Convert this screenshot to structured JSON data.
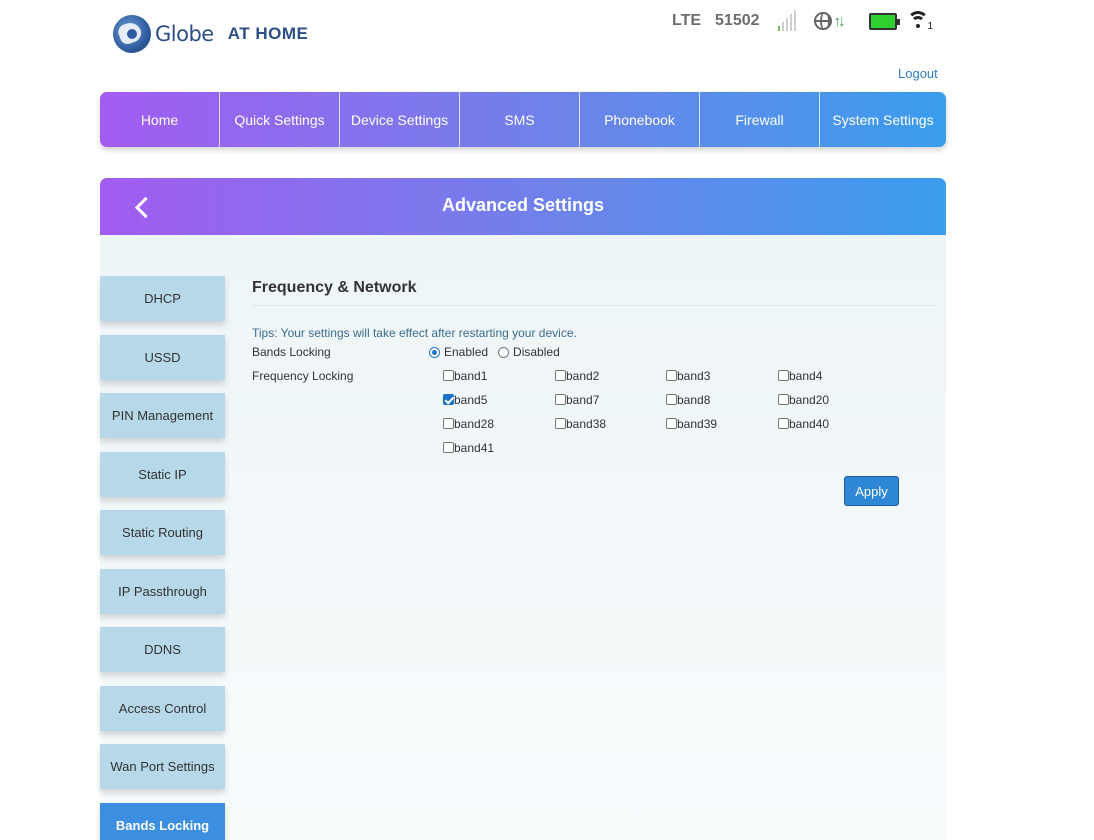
{
  "brand": {
    "name": "Globe",
    "suffix": "AT HOME"
  },
  "status": {
    "network": "LTE",
    "operator": "51502",
    "signal_bars": 1,
    "data_arrows": "↑↓",
    "wifi_clients": "1"
  },
  "header": {
    "logout_label": "Logout"
  },
  "nav": {
    "items": [
      {
        "label": "Home"
      },
      {
        "label": "Quick Settings"
      },
      {
        "label": "Device Settings"
      },
      {
        "label": "SMS"
      },
      {
        "label": "Phonebook"
      },
      {
        "label": "Firewall"
      },
      {
        "label": "System Settings"
      }
    ]
  },
  "panel": {
    "title": "Advanced Settings"
  },
  "sidebar": {
    "items": [
      {
        "label": "DHCP"
      },
      {
        "label": "USSD"
      },
      {
        "label": "PIN Management"
      },
      {
        "label": "Static IP"
      },
      {
        "label": "Static Routing"
      },
      {
        "label": "IP Passthrough"
      },
      {
        "label": "DDNS"
      },
      {
        "label": "Access Control"
      },
      {
        "label": "Wan Port Settings"
      },
      {
        "label": "Bands Locking",
        "active": true
      }
    ]
  },
  "content": {
    "section_title": "Frequency & Network",
    "tips": "Tips: Your settings will take effect after restarting your device.",
    "bands_locking": {
      "label": "Bands Locking",
      "options": [
        {
          "label": "Enabled",
          "selected": true
        },
        {
          "label": "Disabled",
          "selected": false
        }
      ]
    },
    "frequency_locking": {
      "label": "Frequency Locking",
      "bands": [
        {
          "label": "band1",
          "checked": false
        },
        {
          "label": "band2",
          "checked": false
        },
        {
          "label": "band3",
          "checked": false
        },
        {
          "label": "band4",
          "checked": false
        },
        {
          "label": "band5",
          "checked": true
        },
        {
          "label": "band7",
          "checked": false
        },
        {
          "label": "band8",
          "checked": false
        },
        {
          "label": "band20",
          "checked": false
        },
        {
          "label": "band28",
          "checked": false
        },
        {
          "label": "band38",
          "checked": false
        },
        {
          "label": "band39",
          "checked": false
        },
        {
          "label": "band40",
          "checked": false
        },
        {
          "label": "band41",
          "checked": false
        }
      ]
    },
    "apply_label": "Apply"
  }
}
